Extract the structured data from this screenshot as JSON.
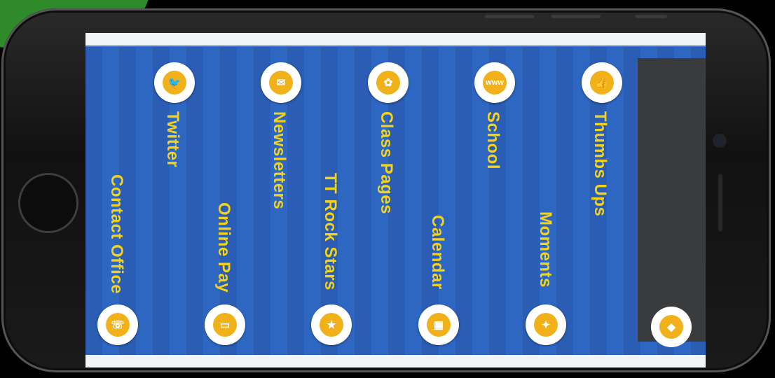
{
  "apps": {
    "top_row": [
      {
        "label": "Thumbs Ups",
        "icon": "thumbs-up-icon",
        "glyph": "👍"
      },
      {
        "label": "School",
        "icon": "www-icon",
        "glyph": "www"
      },
      {
        "label": "Class Pages",
        "icon": "class-pages-icon",
        "glyph": "✿"
      },
      {
        "label": "Newsletters",
        "icon": "newsletter-icon",
        "glyph": "✉"
      },
      {
        "label": "Twitter",
        "icon": "twitter-icon",
        "glyph": "🐦"
      }
    ],
    "bottom_row": [
      {
        "label": "Moments",
        "icon": "moments-icon",
        "glyph": "✦"
      },
      {
        "label": "Calendar",
        "icon": "calendar-icon",
        "glyph": "▦"
      },
      {
        "label": "TT Rock Stars",
        "icon": "rock-stars-icon",
        "glyph": "★"
      },
      {
        "label": "Online Pay",
        "icon": "card-icon",
        "glyph": "▭"
      },
      {
        "label": "Contact Office",
        "icon": "contact-icon",
        "glyph": "☏"
      }
    ]
  },
  "panel": {
    "icon": "share-icon",
    "glyph": "◆"
  },
  "colors": {
    "label": "#f2d21a",
    "icon": "#f1b11a",
    "background": "#2a5db3",
    "panel": "#3a3b3d"
  }
}
